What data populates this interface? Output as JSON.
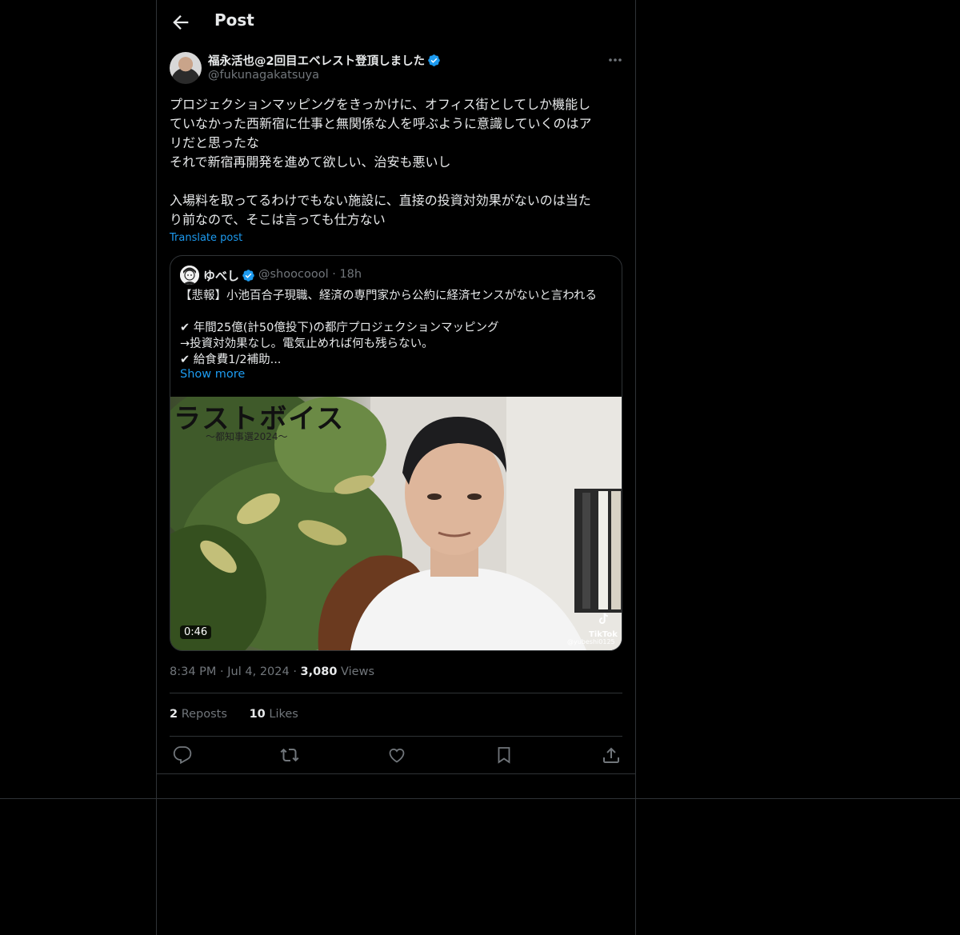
{
  "header": {
    "title": "Post"
  },
  "post": {
    "author_name": "福永活也@2回目エベレスト登頂しました",
    "author_handle": "@fukunagakatsuya",
    "text": "プロジェクションマッピングをきっかけに、オフィス街としてしか機能し\nていなかった西新宿に仕事と無関係な人を呼ぶように意識していくのはア\nリだと思ったな\nそれで新宿再開発を進めて欲しい、治安も悪いし\n\n入場料を取ってるわけでもない施設に、直接の投資対効果がないのは当た\nり前なので、そこは言っても仕方ない",
    "translate_label": "Translate post",
    "time": "8:34 PM",
    "date": "Jul 4, 2024",
    "views_count": "3,080",
    "views_label": "Views",
    "reposts_count": "2",
    "reposts_label": "Reposts",
    "likes_count": "10",
    "likes_label": "Likes"
  },
  "quote": {
    "author_name": "ゆべし",
    "author_handle": "@shoocoool",
    "age": "18h",
    "text": "【悲報】小池百合子現職、経済の専門家から公約に経済センスがないと言われる\n\n✔ 年間25億(計50億投下)の都庁プロジェクションマッピング\n→投資対効果なし。電気止めれば何も残らない。\n✔ 給食費1/2補助...",
    "show_more": "Show more",
    "video": {
      "duration": "0:46",
      "overlay_title": "ラストボイス",
      "overlay_subtitle": "〜都知事選2024〜",
      "watermark_brand": "TikTok",
      "watermark_user": "@yubeshi0125"
    }
  },
  "colors": {
    "accent": "#1d9bf0",
    "muted": "#71767b",
    "text": "#e7e9ea",
    "border": "#2f3336",
    "background": "#000000"
  },
  "icons": {
    "back": "arrow-left-icon",
    "more": "more-horizontal-icon",
    "verified": "verified-badge-icon",
    "reply": "reply-icon",
    "repost": "repost-icon",
    "like": "heart-icon",
    "bookmark": "bookmark-icon",
    "share": "share-icon"
  }
}
